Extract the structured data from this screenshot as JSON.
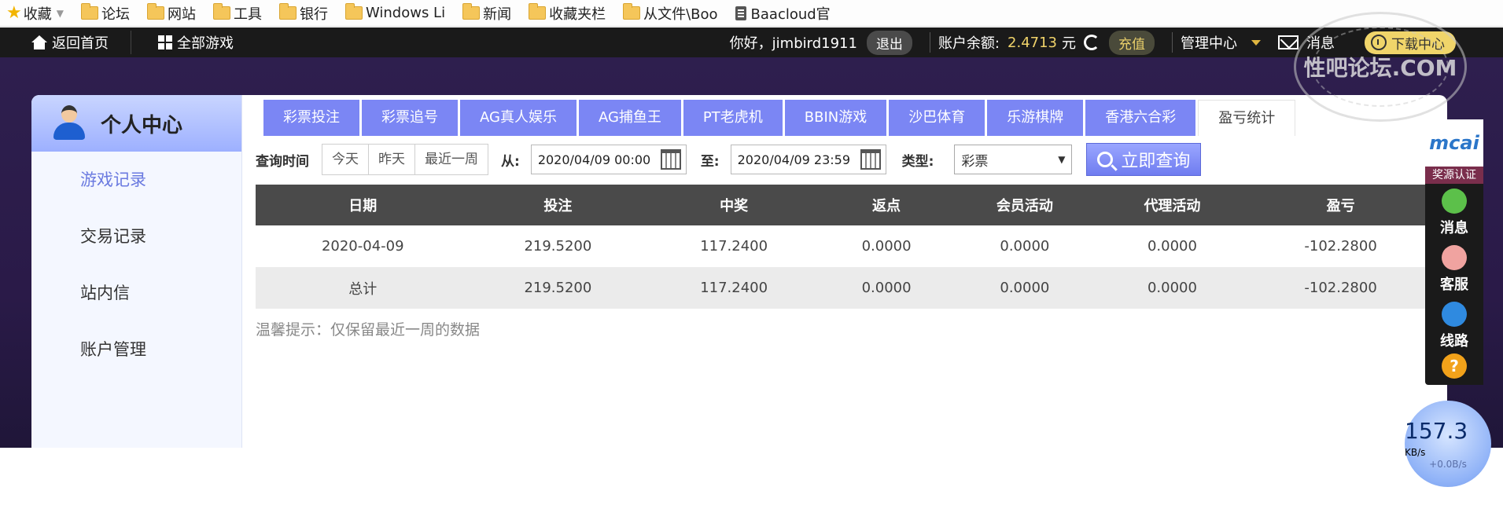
{
  "bookmarks": [
    {
      "label": "收藏",
      "type": "star"
    },
    {
      "label": "论坛",
      "type": "folder"
    },
    {
      "label": "网站",
      "type": "folder"
    },
    {
      "label": "工具",
      "type": "folder"
    },
    {
      "label": "银行",
      "type": "folder"
    },
    {
      "label": "Windows Li",
      "type": "folder"
    },
    {
      "label": "新闻",
      "type": "folder"
    },
    {
      "label": "收藏夹栏",
      "type": "folder"
    },
    {
      "label": "从文件\\Boo",
      "type": "folder"
    },
    {
      "label": "Baacloud官",
      "type": "doc"
    }
  ],
  "topnav": {
    "home": "返回首页",
    "all_games": "全部游戏",
    "greeting": "你好，jimbird1911",
    "logout": "退出",
    "balance_label": "账户余额:",
    "balance_value": "2.4713",
    "currency": "元",
    "recharge": "充值",
    "admin": "管理中心",
    "messages": "消息",
    "download": "下载中心"
  },
  "sidebar": {
    "title": "个人中心",
    "items": [
      {
        "label": "游戏记录",
        "active": true
      },
      {
        "label": "交易记录",
        "active": false
      },
      {
        "label": "站内信",
        "active": false
      },
      {
        "label": "账户管理",
        "active": false
      }
    ]
  },
  "tabs": [
    "彩票投注",
    "彩票追号",
    "AG真人娱乐",
    "AG捕鱼王",
    "PT老虎机",
    "BBIN游戏",
    "沙巴体育",
    "乐游棋牌",
    "香港六合彩",
    "盈亏统计"
  ],
  "active_tab": "盈亏统计",
  "query": {
    "label": "查询时间",
    "quick": [
      "今天",
      "昨天",
      "最近一周"
    ],
    "from_label": "从:",
    "from_value": "2020/04/09 00:00",
    "to_label": "至:",
    "to_value": "2020/04/09 23:59",
    "type_label": "类型:",
    "type_value": "彩票",
    "search": "立即查询"
  },
  "table": {
    "headers": [
      "日期",
      "投注",
      "中奖",
      "返点",
      "会员活动",
      "代理活动",
      "盈亏"
    ],
    "rows": [
      [
        "2020-04-09",
        "219.5200",
        "117.2400",
        "0.0000",
        "0.0000",
        "0.0000",
        "-102.2800"
      ],
      [
        "总计",
        "219.5200",
        "117.2400",
        "0.0000",
        "0.0000",
        "0.0000",
        "-102.2800"
      ]
    ]
  },
  "tip": "温馨提示：仅保留最近一周的数据",
  "float_panel": {
    "brand": "mcai",
    "cert": "奖源认证",
    "items": [
      "消息",
      "客服",
      "线路"
    ],
    "help": "?"
  },
  "speed": {
    "value": "157.3",
    "unit": "KB/s",
    "sub": "+0.0B/s"
  },
  "watermark": "性吧论坛.COM",
  "colors": {
    "accent": "#7b86f4",
    "balance": "#f0d36a",
    "nav_bg": "#1a1a1a"
  }
}
